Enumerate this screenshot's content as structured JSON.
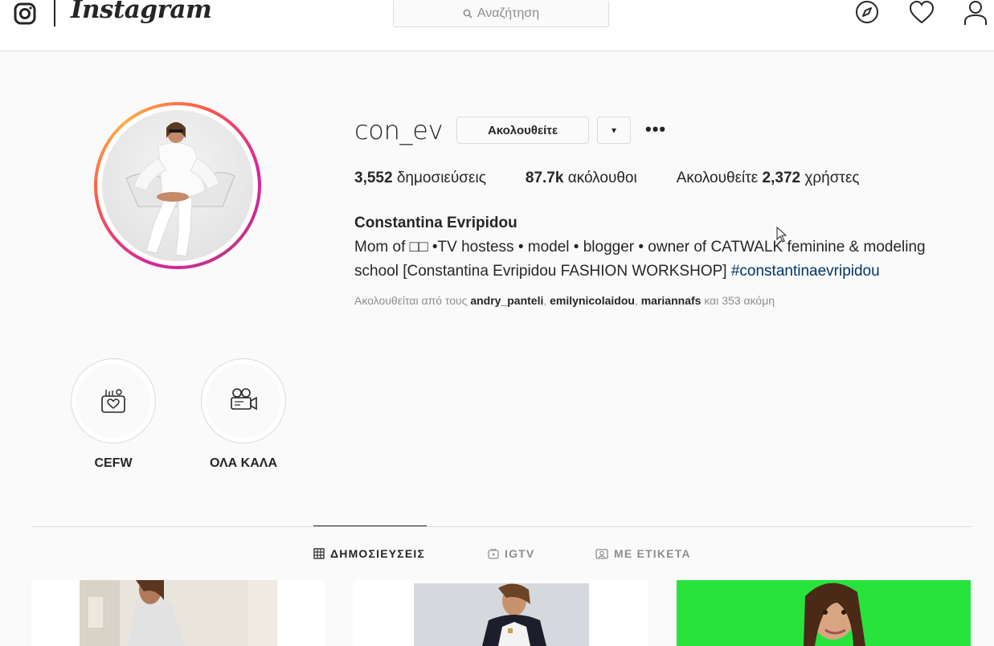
{
  "nav": {
    "wordmark": "Instagram",
    "search_placeholder": "Αναζήτηση",
    "icons": [
      "instagram-camera-icon",
      "compass-icon",
      "heart-icon",
      "user-icon"
    ]
  },
  "profile": {
    "username": "con_ev",
    "follow_label": "Ακολουθείτε",
    "dropdown_label": "▾",
    "more_label": "•••",
    "stats": {
      "posts_count": "3,552",
      "posts_label": "δημοσιεύσεις",
      "followers_count": "87.7k",
      "followers_label": "ακόλουθοι",
      "following_prefix": "Ακολουθείτε",
      "following_count": "2,372",
      "following_label": "χρήστες"
    },
    "full_name": "Constantina Evripidou",
    "bio_text": "Mom of □□ •TV hostess • model • blogger • owner of CATWALK feminine & modeling school [Constantina Evripidou FASHION WORKSHOP]",
    "bio_hashtag": "#constantinaevripidou",
    "followed_by": {
      "prefix": "Ακολουθείται από τους",
      "user1": "andry_panteli",
      "sep1": ", ",
      "user2": "emilynicolaidou",
      "sep2": ", ",
      "user3": "mariannafs",
      "suffix": "και 353 ακόμη"
    }
  },
  "highlights": [
    {
      "label": "CEFW",
      "icon": "makeup-bag-heart-icon"
    },
    {
      "label": "ΟΛΑ ΚΑΛΑ",
      "icon": "video-camera-icon"
    }
  ],
  "tabs": [
    {
      "label": "ΔΗΜΟΣΙΕΥΣΕΙΣ",
      "icon": "grid-icon",
      "active": true
    },
    {
      "label": "IGTV",
      "icon": "igtv-icon",
      "active": false
    },
    {
      "label": "ΜΕ ΕΤΙΚΕΤΑ",
      "icon": "tagged-icon",
      "active": false
    }
  ],
  "colors": {
    "ring_gradient": [
      "#d6249f",
      "#fd5949",
      "#fcaf45"
    ],
    "hashtag": "#003569",
    "secondary_text": "#8e8e8e",
    "green_post": "#29e33d"
  }
}
